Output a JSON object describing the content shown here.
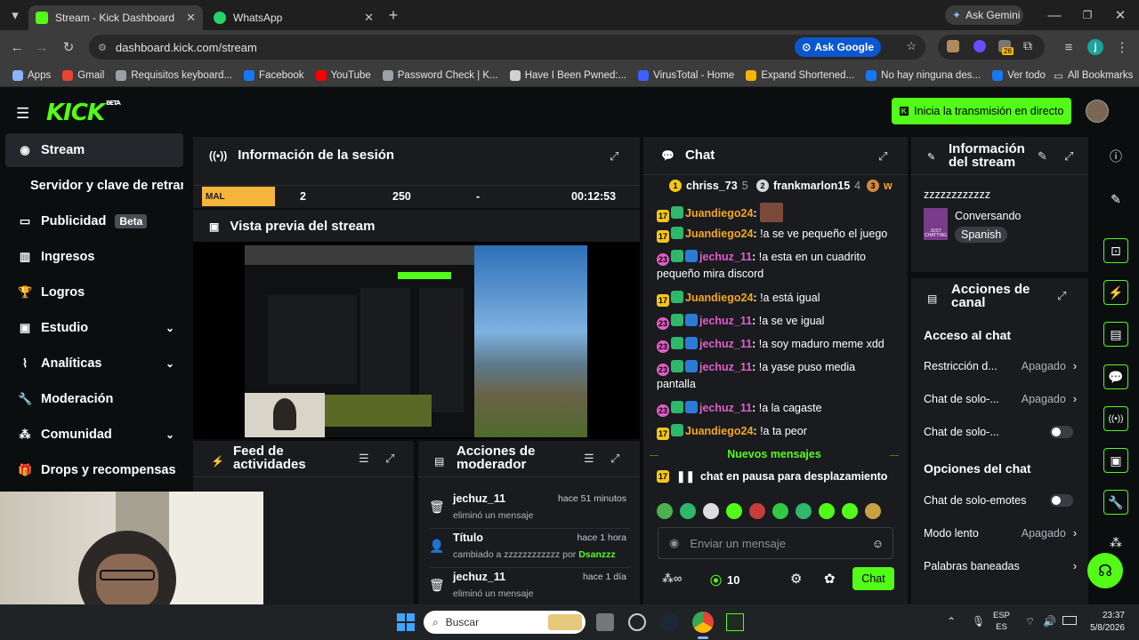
{
  "browser": {
    "tabs": [
      {
        "label": "Stream - Kick Dashboard",
        "active": true
      },
      {
        "label": "WhatsApp",
        "active": false
      }
    ],
    "gemini_label": "Ask Gemini",
    "url": "dashboard.kick.com/stream",
    "ask_google": "Ask Google",
    "extension_badge": "26",
    "profile_initial": "j",
    "bookmarks": [
      {
        "label": "Apps",
        "color": "#8ab4f8"
      },
      {
        "label": "Gmail",
        "color": "#ea4335"
      },
      {
        "label": "Requisitos keyboard...",
        "color": "#9aa0a6"
      },
      {
        "label": "Facebook",
        "color": "#1877f2"
      },
      {
        "label": "YouTube",
        "color": "#ff0000"
      },
      {
        "label": "Password Check | K...",
        "color": "#9aa0a6"
      },
      {
        "label": "Have I Been Pwned:...",
        "color": "#d0d0d0"
      },
      {
        "label": "VirusTotal - Home",
        "color": "#3b61ff"
      },
      {
        "label": "Expand Shortened...",
        "color": "#f4b400"
      },
      {
        "label": "No hay ninguna des...",
        "color": "#1877f2"
      },
      {
        "label": "Ver todo",
        "color": "#1877f2"
      }
    ],
    "all_bookmarks": "All Bookmarks"
  },
  "kick": {
    "logo": "KICK",
    "logo_sup": "BETA",
    "go_live_label": "Inicia la transmisión en directo",
    "sidebar": [
      {
        "label": "Stream",
        "icon": "broadcast-icon",
        "active": true
      },
      {
        "label": "Servidor y clave de retransmisión",
        "icon": "",
        "active": false
      },
      {
        "label": "Publicidad",
        "icon": "ad-icon",
        "badge": "Beta"
      },
      {
        "label": "Ingresos",
        "icon": "chart-icon"
      },
      {
        "label": "Logros",
        "icon": "trophy-icon"
      },
      {
        "label": "Estudio",
        "icon": "clapperboard-icon",
        "chevron": true
      },
      {
        "label": "Analíticas",
        "icon": "analytics-icon",
        "chevron": true
      },
      {
        "label": "Moderación",
        "icon": "wrench-icon"
      },
      {
        "label": "Comunidad",
        "icon": "community-icon",
        "chevron": true
      },
      {
        "label": "Drops y recompensas",
        "icon": "gift-icon"
      }
    ],
    "session": {
      "title": "Información de la sesión",
      "stats": [
        "MAL",
        "2",
        "250",
        "-",
        "00:12:53"
      ]
    },
    "preview": {
      "title": "Vista previa del stream"
    },
    "feed": {
      "title": "Feed de actividades"
    },
    "modactions": {
      "title": "Acciones de moderador",
      "items": [
        {
          "user": "jechuz_11",
          "time": "hace 51 minutos",
          "detail": "eliminó un mensaje"
        },
        {
          "user": "Título",
          "time": "hace 1 hora",
          "detail": "cambiado a zzzzzzzzzzzz por",
          "by": "Dsanzzz"
        },
        {
          "user": "jechuz_11",
          "time": "hace 1 día",
          "detail": "eliminó un mensaje"
        }
      ]
    },
    "chat": {
      "title": "Chat",
      "top": [
        {
          "rank": "1",
          "name": "chriss_73",
          "count": "5"
        },
        {
          "rank": "2",
          "name": "frankmarlon15",
          "count": "4"
        },
        {
          "rank": "3",
          "name": "w",
          "count": ""
        }
      ],
      "messages": [
        {
          "sub": "17",
          "user": "Juandiego24",
          "text": ""
        },
        {
          "sub": "17",
          "user": "Juandiego24",
          "text": "!a se ve pequeño el juego"
        },
        {
          "sub": "23",
          "user": "jechuz_11",
          "text": "!a esta en un cuadrito pequeño mira discord"
        },
        {
          "sub": "17",
          "user": "Juandiego24",
          "text": "!a está igual"
        },
        {
          "sub": "23",
          "user": "jechuz_11",
          "text": "!a se ve igual"
        },
        {
          "sub": "23",
          "user": "jechuz_11",
          "text": "!a soy maduro meme xdd"
        },
        {
          "sub": "23",
          "user": "jechuz_11",
          "text": "!a yase puso media pantalla"
        },
        {
          "sub": "23",
          "user": "jechuz_11",
          "text": "!a la cagaste"
        },
        {
          "sub": "17",
          "user": "Juandiego24",
          "text": "!a ta peor"
        }
      ],
      "new_messages": "Nuevos mensajes",
      "paused": "chat en pausa para desplazamiento",
      "input_placeholder": "Enviar un mensaje",
      "points": "10",
      "send_label": "Chat",
      "user_color": "#f5a623",
      "mod_color": "#e05fc9"
    },
    "stream_info": {
      "title": "Información del stream",
      "stream_title": "zzzzzzzzzzzz",
      "category": "Conversando",
      "language": "Spanish",
      "category_thumb_text": "JUST CHATTING"
    },
    "channel": {
      "title": "Acciones de canal",
      "section1": "Acceso al chat",
      "rows1": [
        {
          "label": "Restricción d...",
          "value": "Apagado",
          "kind": "arrow"
        },
        {
          "label": "Chat de solo-...",
          "value": "Apagado",
          "kind": "arrow"
        },
        {
          "label": "Chat de solo-...",
          "value": "",
          "kind": "toggle"
        }
      ],
      "section2": "Opciones del chat",
      "rows2": [
        {
          "label": "Chat de solo-emotes",
          "value": "",
          "kind": "toggle"
        },
        {
          "label": "Modo lento",
          "value": "Apagado",
          "kind": "arrow"
        },
        {
          "label": "Palabras baneadas",
          "value": "",
          "kind": "arrow"
        }
      ]
    }
  },
  "taskbar": {
    "search_placeholder": "Buscar",
    "lang_top": "ESP",
    "lang_bottom": "ES",
    "time": "23:37",
    "date": "5/8/2026"
  }
}
